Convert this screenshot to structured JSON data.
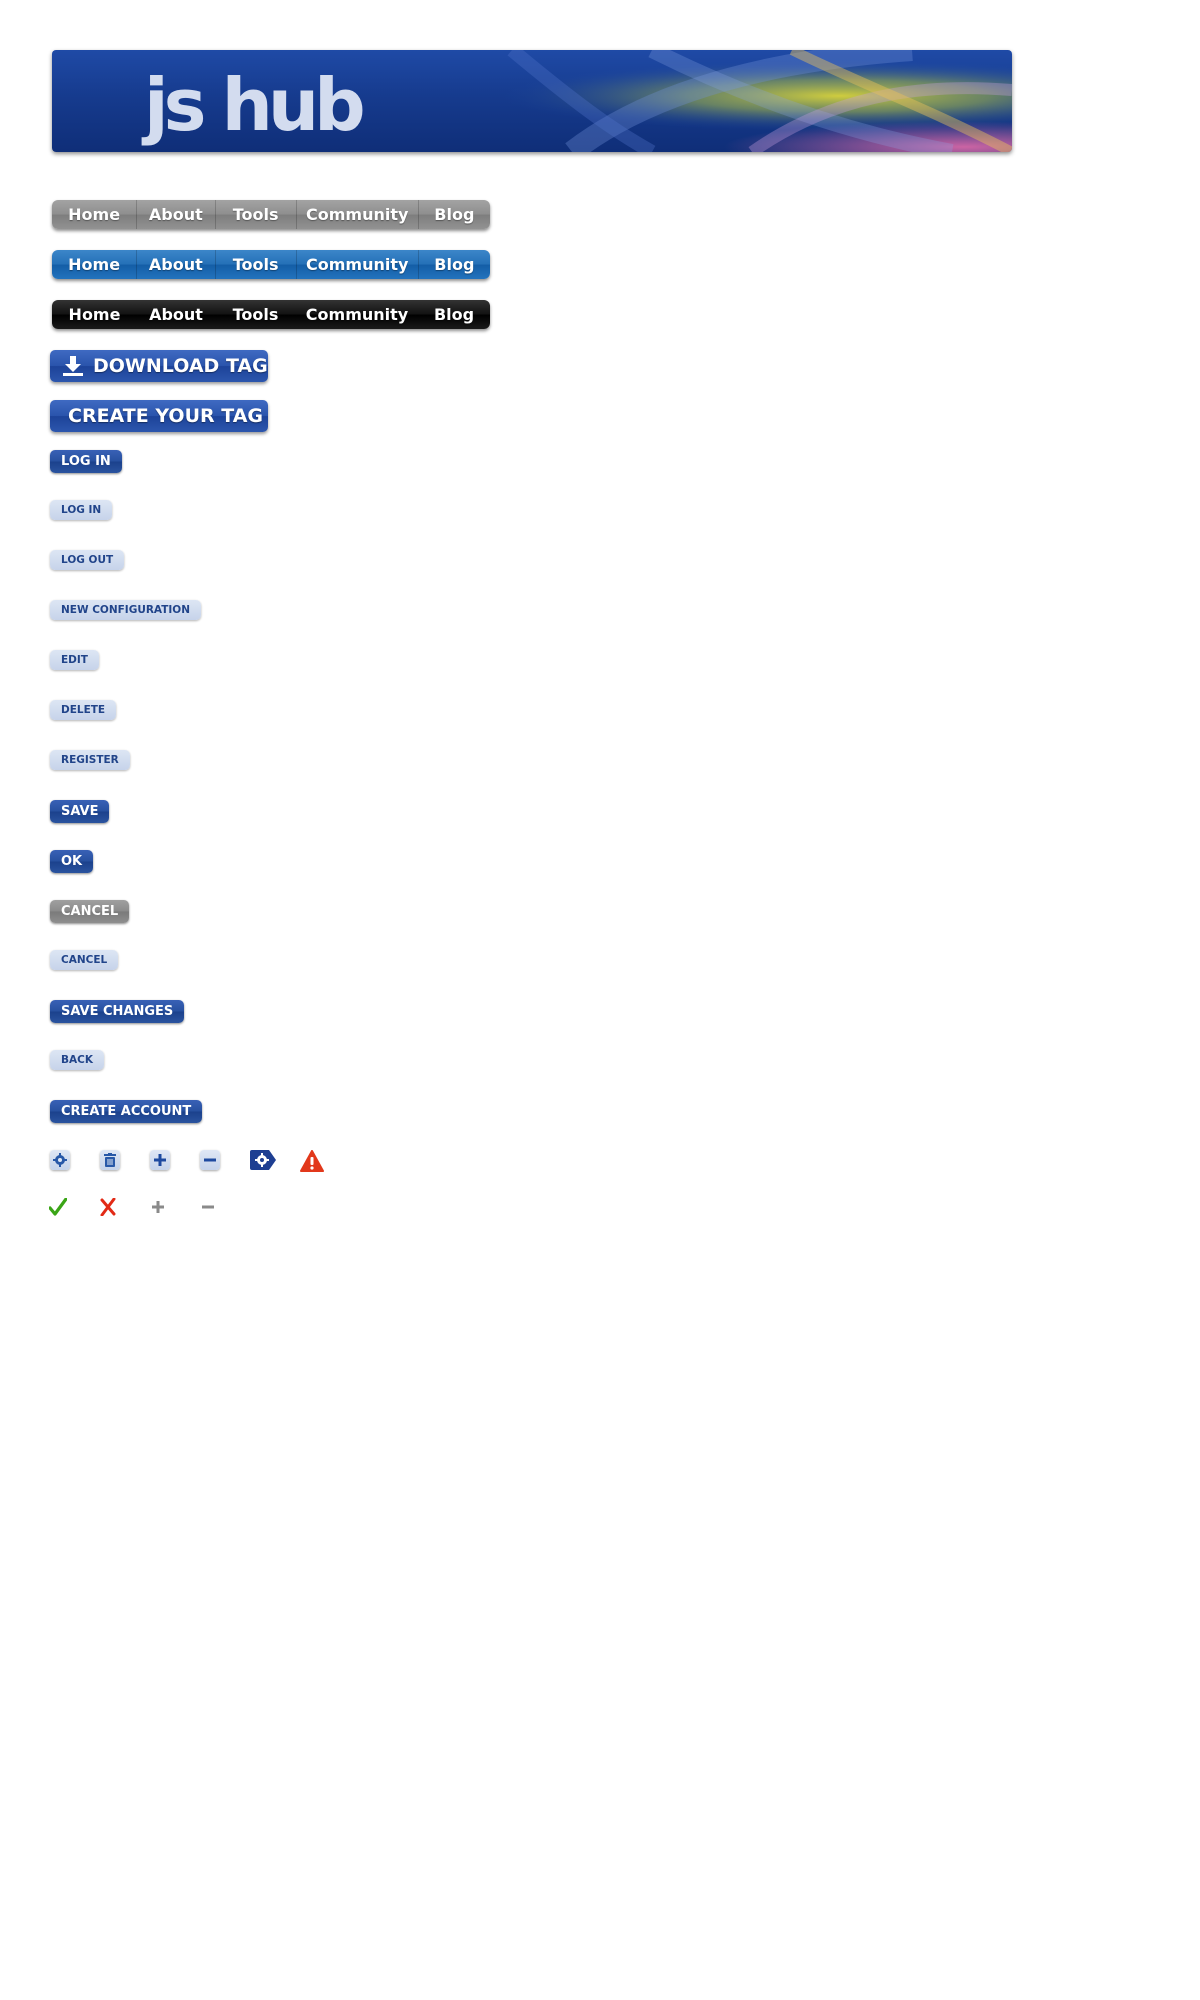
{
  "header": {
    "logo_text": "js hub",
    "logo_brand": "jshub"
  },
  "nav_items": [
    "Home",
    "About",
    "Tools",
    "Community",
    "Blog"
  ],
  "navs": {
    "gray": [
      "Home",
      "About",
      "Tools",
      "Community",
      "Blog"
    ],
    "blue": [
      "Home",
      "About",
      "Tools",
      "Community",
      "Blog"
    ],
    "black": [
      "Home",
      "About",
      "Tools",
      "Community",
      "Blog"
    ]
  },
  "buttons": {
    "download_tag": "DOWNLOAD TAG",
    "create_your_tag": "CREATE YOUR TAG",
    "log_in_dark": "LOG IN",
    "log_in_light": "LOG IN",
    "log_out": "LOG OUT",
    "new_configuration": "NEW CONFIGURATION",
    "edit": "EDIT",
    "delete": "DELETE",
    "register": "REGISTER",
    "save": "SAVE",
    "ok": "OK",
    "cancel_gray": "CANCEL",
    "cancel_light": "CANCEL",
    "save_changes": "SAVE CHANGES",
    "back": "BACK",
    "create_account": "CREATE ACCOUNT"
  },
  "icons_row1": [
    "gear-icon",
    "trash-icon",
    "plus-icon",
    "minus-icon",
    "tag-gear-icon",
    "warning-icon"
  ],
  "icons_row2": [
    "checkmark-icon",
    "cross-icon",
    "plus-gray-icon",
    "minus-gray-icon"
  ],
  "colors": {
    "brand_blue": "#1f4aa6",
    "nav_gray": "#8e8e8e",
    "nav_blue": "#2470b7",
    "nav_black": "#111111",
    "light_button": "#c6d3ea",
    "check_green": "#3aa516",
    "cross_red": "#e22a16",
    "warning_red": "#e2381b"
  }
}
